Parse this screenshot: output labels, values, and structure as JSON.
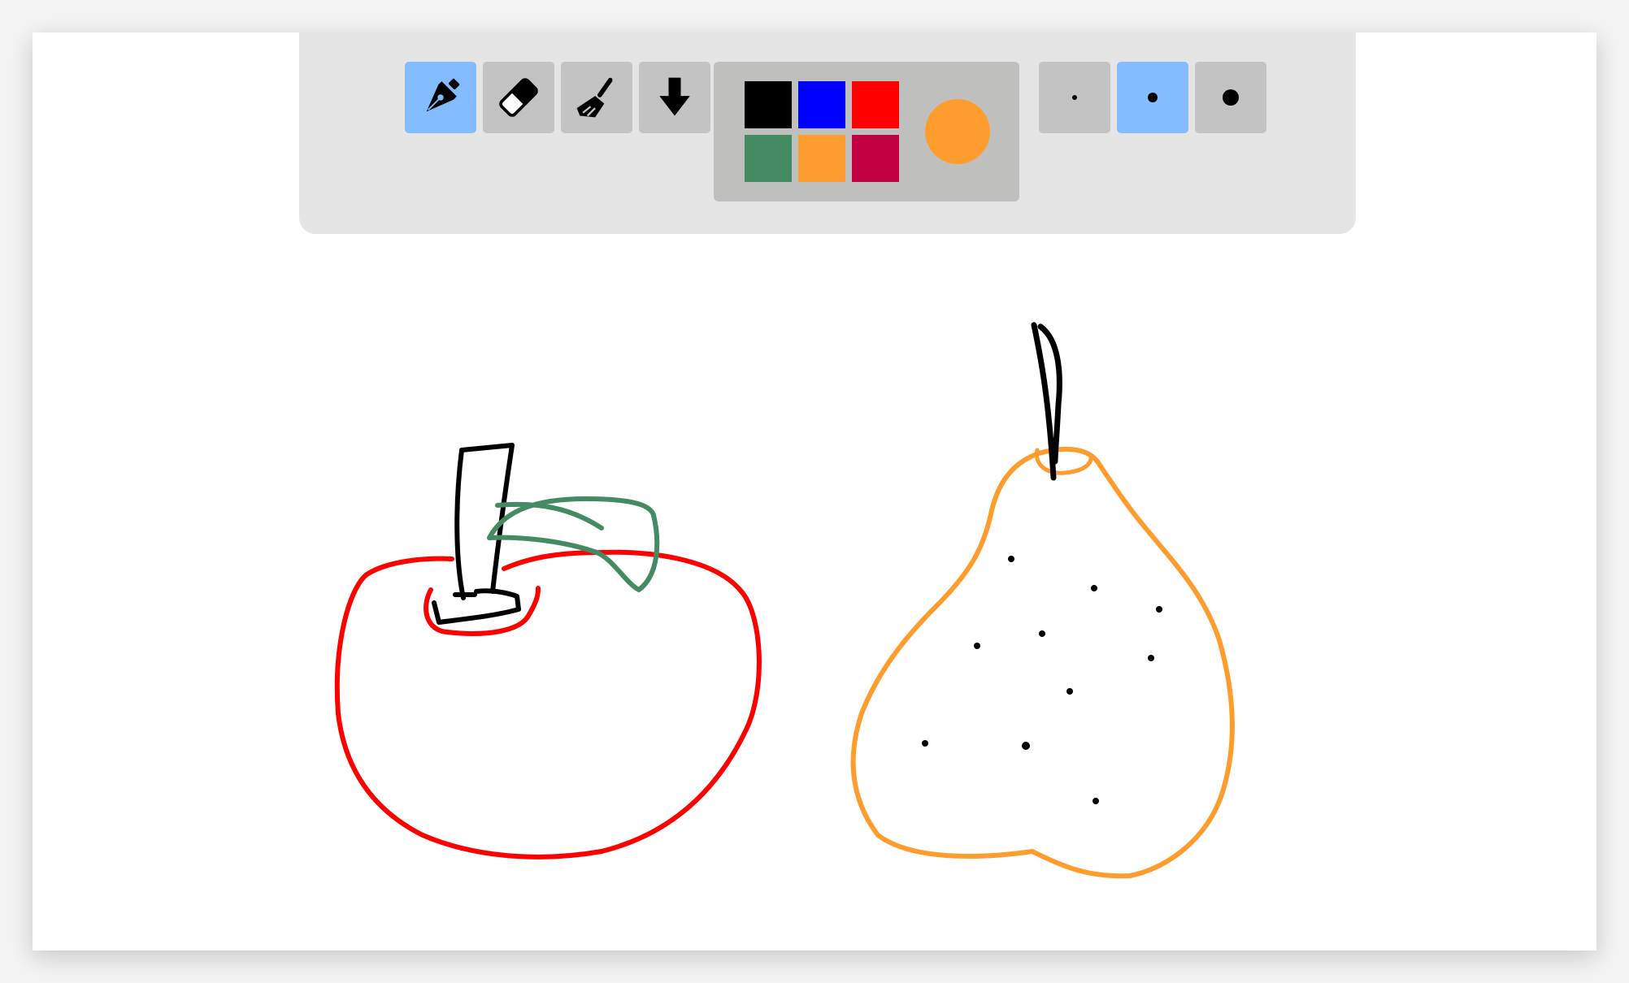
{
  "toolbar": {
    "tools": [
      {
        "name": "pen",
        "icon": "pen-nib-icon",
        "active": true
      },
      {
        "name": "eraser",
        "icon": "eraser-icon",
        "active": false
      },
      {
        "name": "clear",
        "icon": "broom-icon",
        "active": false
      },
      {
        "name": "download",
        "icon": "download-arrow-icon",
        "active": false
      }
    ],
    "palette": {
      "colors": [
        "#000000",
        "#0000ff",
        "#ff0000",
        "#448a63",
        "#ff9c2e",
        "#c00040"
      ],
      "current_color": "#ff9c2e"
    },
    "brush_sizes": [
      {
        "name": "small",
        "active": false
      },
      {
        "name": "medium",
        "active": true
      },
      {
        "name": "large",
        "active": false
      }
    ],
    "active_button_color": "#83bcff"
  },
  "canvas": {
    "drawings": [
      {
        "subject": "apple",
        "stroke_colors": [
          "#ff0000",
          "#000000",
          "#448a63"
        ]
      },
      {
        "subject": "pear",
        "stroke_colors": [
          "#ff9c2e",
          "#000000"
        ]
      }
    ]
  }
}
